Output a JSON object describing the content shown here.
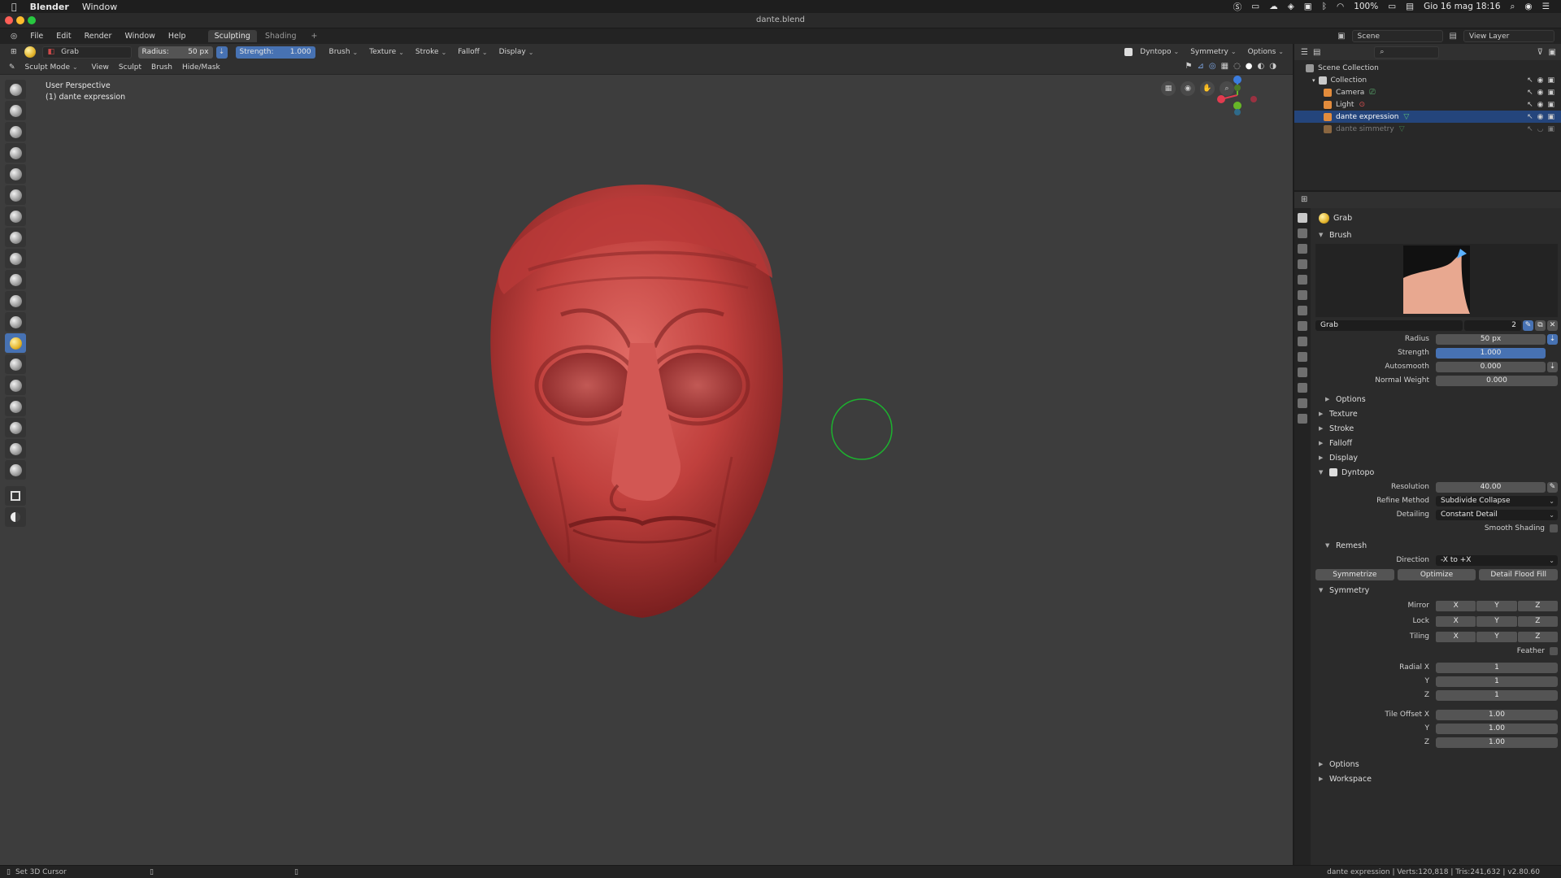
{
  "macos": {
    "app_name": "Blender",
    "menu_window": "Window",
    "battery": "100%",
    "clock": "Gio 16 mag  18:16"
  },
  "window": {
    "title": "dante.blend"
  },
  "topbar": {
    "menus": [
      "File",
      "Edit",
      "Render",
      "Window",
      "Help"
    ],
    "workspace_tabs": [
      "Sculpting",
      "Shading"
    ],
    "add_tab": "+",
    "scene": "Scene",
    "view_layer": "View Layer"
  },
  "toolheader": {
    "brush_name": "Grab",
    "radius_label": "Radius:",
    "radius_value": "50 px",
    "strength_label": "Strength:",
    "strength_value": "1.000",
    "menus": [
      "Brush",
      "Texture",
      "Stroke",
      "Falloff",
      "Display"
    ],
    "dyntopo": "Dyntopo",
    "symmetry": "Symmetry",
    "options": "Options"
  },
  "modeheader": {
    "mode": "Sculpt Mode",
    "menus": [
      "View",
      "Sculpt",
      "Brush",
      "Hide/Mask"
    ]
  },
  "viewport": {
    "perspective": "User Perspective",
    "object": "(1) dante expression"
  },
  "outliner": {
    "root": "Scene Collection",
    "collection": "Collection",
    "items": [
      {
        "name": "Camera",
        "state": "normal"
      },
      {
        "name": "Light",
        "state": "normal"
      },
      {
        "name": "dante expression",
        "state": "selected"
      },
      {
        "name": "dante simmetry",
        "state": "dim"
      }
    ]
  },
  "properties": {
    "active_tool": "Grab",
    "brush_panel": "Brush",
    "brush_datablock": "Grab",
    "brush_users": "2",
    "fields": {
      "radius_label": "Radius",
      "radius_value": "50 px",
      "strength_label": "Strength",
      "strength_value": "1.000",
      "autosmooth_label": "Autosmooth",
      "autosmooth_value": "0.000",
      "normal_weight_label": "Normal Weight",
      "normal_weight_value": "0.000"
    },
    "options_sub": "Options",
    "collapsed_panels": [
      "Texture",
      "Stroke",
      "Falloff",
      "Display"
    ],
    "dyntopo": {
      "title": "Dyntopo",
      "resolution_label": "Resolution",
      "resolution_value": "40.00",
      "refine_label": "Refine Method",
      "refine_value": "Subdivide Collapse",
      "detailing_label": "Detailing",
      "detailing_value": "Constant Detail",
      "smooth_shading": "Smooth Shading",
      "remesh": "Remesh",
      "direction_label": "Direction",
      "direction_value": "-X to +X",
      "buttons": [
        "Symmetrize",
        "Optimize",
        "Detail Flood Fill"
      ]
    },
    "symmetry": {
      "title": "Symmetry",
      "mirror": "Mirror",
      "lock": "Lock",
      "tiling": "Tiling",
      "axes": [
        "X",
        "Y",
        "Z"
      ],
      "feather": "Feather",
      "radial_x_label": "Radial X",
      "radial_x": "1",
      "y_label": "Y",
      "radial_y": "1",
      "z_label": "Z",
      "radial_z": "1",
      "tile_offset_x_label": "Tile Offset X",
      "tile_offset_x": "1.00",
      "tile_offset_y": "1.00",
      "tile_offset_z": "1.00"
    },
    "bottom_panels": [
      "Options",
      "Workspace"
    ]
  },
  "statusbar": {
    "left": "Set 3D Cursor",
    "right": "dante expression | Verts:120,818 | Tris:241,632 | v2.80.60"
  },
  "colors": {
    "accent": "#4772b3",
    "selection": "#24457c",
    "viewport_bg": "#3d3d3d",
    "mesh": "#c03c3c",
    "cursor_ring": "#1db12f"
  }
}
